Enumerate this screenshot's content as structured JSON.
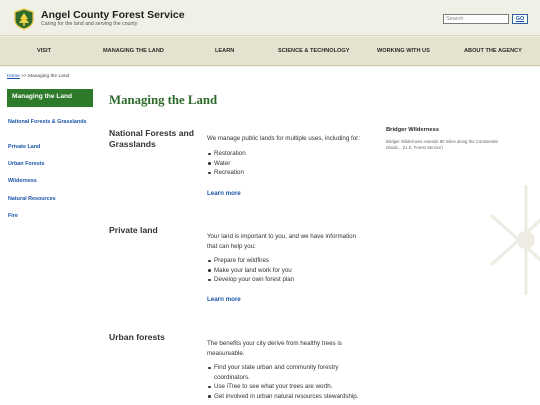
{
  "brand": {
    "title": "Angel County Forest Service",
    "tagline": "Caring for the land and serving the county"
  },
  "search": {
    "placeholder": "Search",
    "button_label": "GO"
  },
  "nav": {
    "items": [
      "VISIT",
      "MANAGING THE LAND",
      "LEARN",
      "SCIENCE & TECHNOLOGY",
      "WORKING WITH US",
      "ABOUT THE AGENCY"
    ]
  },
  "breadcrumb": {
    "home": "Home",
    "separator": " >> ",
    "current": "Managing the Land"
  },
  "sidebar": {
    "active": "Managing the Land",
    "items": [
      "National Forests & Grasslands",
      "Private Land",
      "Urban Forests",
      "Wilderness",
      "Natural Resources",
      "Fire"
    ]
  },
  "main": {
    "title": "Managing the Land",
    "sections": [
      {
        "title": "National Forests and Grasslands",
        "intro": "We manage public lands for multiple uses, including for:",
        "bullets": [
          "Restoration",
          "Water",
          "Recreation"
        ],
        "link": "Learn more"
      },
      {
        "title": "Private land",
        "intro": "Your land is important to you, and we have information that can help you:",
        "bullets": [
          "Prepare for wildfires",
          "Make your land work for you",
          "Develop your own forest plan"
        ],
        "link": "Learn more"
      },
      {
        "title": "Urban forests",
        "intro": "The benefits your city derive from healthy trees is measureable.",
        "bullets": [
          "Find your state urban and community forestry coordinators.",
          "Use iTree to see what your trees are worth.",
          "Get involved in urban natural resources stewardship."
        ]
      }
    ]
  },
  "aside": {
    "title": "Bridger Wilderness",
    "text": "Bridger Wilderness extends 80 miles along the Continental Divide... (U.S. Forest Service)"
  },
  "colors": {
    "accent_green": "#2d7a2b",
    "heading_green": "#2d6a2a",
    "link_blue": "#1a55a8",
    "header_bg": "#f1f0e6",
    "nav_bg": "#e5e3cf"
  },
  "icons": {
    "logo": "forest-service-shield-icon"
  }
}
